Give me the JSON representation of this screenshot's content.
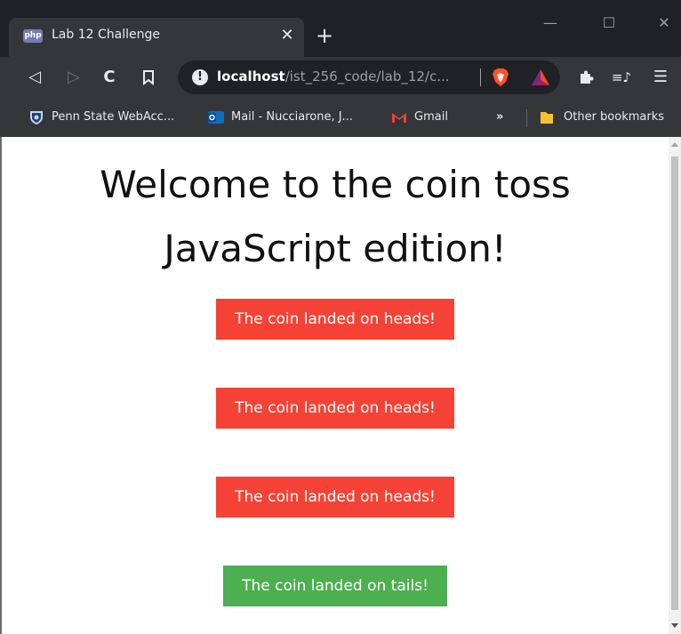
{
  "browser": {
    "tab": {
      "favicon_text": "php",
      "title": "Lab 12 Challenge",
      "close_glyph": "✕"
    },
    "new_tab_glyph": "+",
    "window_controls": {
      "minimize": "—",
      "maximize": "☐",
      "close": "✕"
    },
    "toolbar": {
      "back": "◁",
      "forward": "▷",
      "reload": "C",
      "bookmark": "⊓",
      "extensions": "puzzle-icon",
      "playlist": "≡♪",
      "menu": "☰"
    },
    "address_bar": {
      "info_glyph": "!",
      "host": "localhost",
      "path": "/ist_256_code/lab_12/c..."
    },
    "bookmarks": [
      {
        "label": "Penn State WebAcc...",
        "icon": "penn-state-shield-icon"
      },
      {
        "label": "Mail - Nucciarone, J...",
        "icon": "outlook-icon"
      },
      {
        "label": "Gmail",
        "icon": "gmail-icon"
      }
    ],
    "bookmarks_overflow": "»",
    "other_bookmarks": "Other bookmarks"
  },
  "page": {
    "heading_line1": "Welcome to the coin toss",
    "heading_line2": "JavaScript edition!",
    "results": [
      {
        "text": "The coin landed on heads!",
        "outcome": "heads"
      },
      {
        "text": "The coin landed on heads!",
        "outcome": "heads"
      },
      {
        "text": "The coin landed on heads!",
        "outcome": "heads"
      },
      {
        "text": "The coin landed on tails!",
        "outcome": "tails"
      }
    ]
  },
  "colors": {
    "heads": "#f44336",
    "tails": "#4caf50",
    "tab_strip": "#202124",
    "toolbar": "#35363a"
  }
}
